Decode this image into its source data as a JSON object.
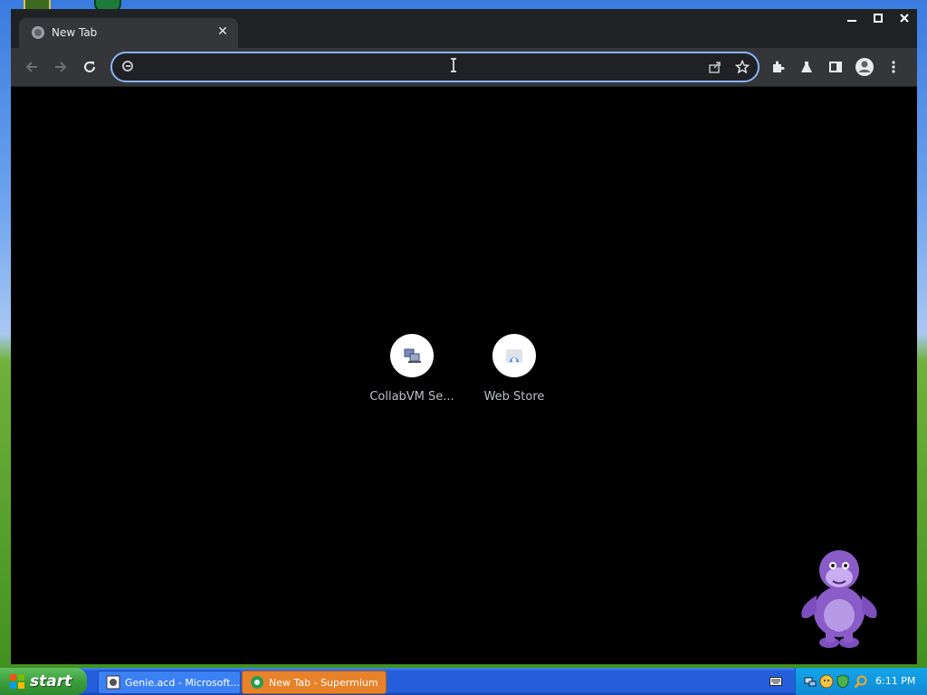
{
  "browser": {
    "tab_title": "New Tab",
    "tab_close_icon": "close-icon",
    "window_controls": [
      "minimize-icon",
      "maximize-icon",
      "close-icon"
    ],
    "toolbar_icons": [
      "back-arrow-icon",
      "forward-arrow-icon",
      "reload-icon"
    ],
    "omnibox": {
      "value": "",
      "placeholder": ""
    },
    "omnibox_icons": [
      "share-icon",
      "star-icon"
    ],
    "extension_icons": [
      "puzzle-icon",
      "labs-flask-icon",
      "side-panel-icon",
      "profile-avatar-icon",
      "kebab-menu-icon"
    ],
    "accent_color": "#8ab4f8"
  },
  "ntp": {
    "shortcuts": [
      {
        "label": "CollabVM Se...",
        "icon": "computers-icon"
      },
      {
        "label": "Web Store",
        "icon": "web-store-icon"
      }
    ]
  },
  "taskbar": {
    "start_label": "start",
    "tasks": [
      {
        "label": "Genie.acd - Microsoft...",
        "icon": "agent-character-editor-icon"
      },
      {
        "label": "New Tab - Supermium",
        "icon": "supermium-icon"
      }
    ],
    "clock": "6:11 PM",
    "tray_icons": [
      "network-icon",
      "bonzi-icon",
      "shield-icon",
      "search-icon"
    ]
  }
}
